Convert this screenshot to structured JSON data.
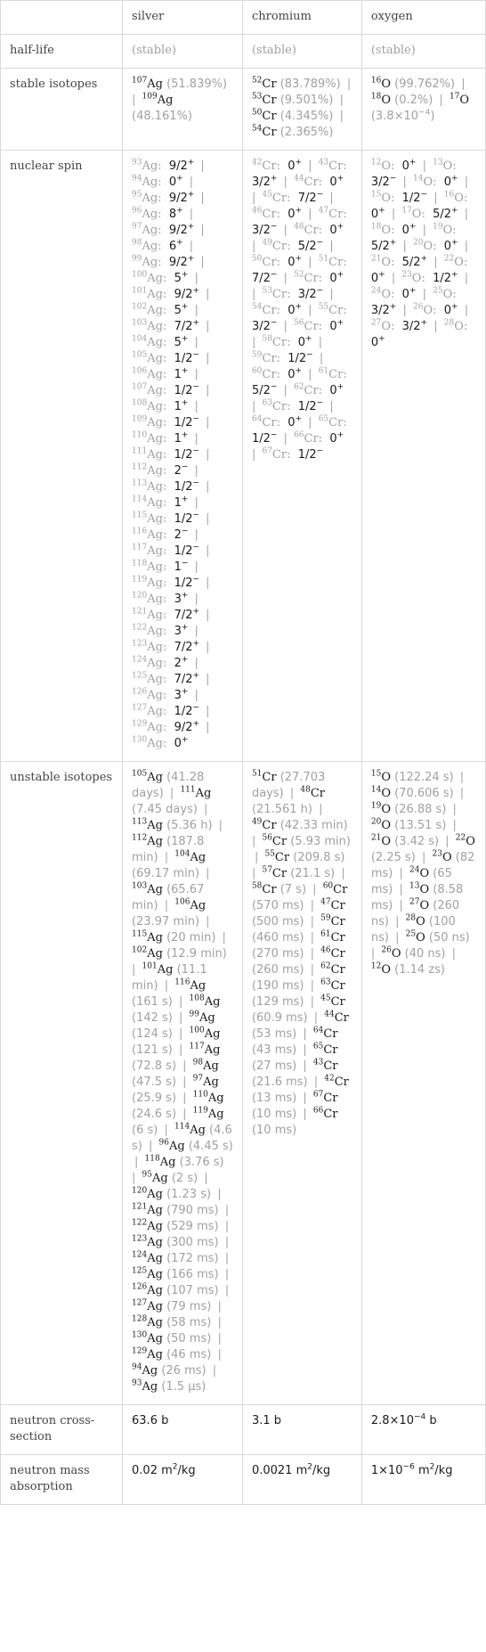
{
  "header": {
    "empty": "",
    "columns": [
      "silver",
      "chromium",
      "oxygen"
    ]
  },
  "rows": {
    "half_life": {
      "label": "half-life",
      "values": [
        "(stable)",
        "(stable)",
        "(stable)"
      ]
    },
    "stable_isotopes": {
      "label": "stable isotopes",
      "values": [
        [
          {
            "mass": "107",
            "sym": "Ag",
            "note": "(51.839%)"
          },
          {
            "mass": "109",
            "sym": "Ag",
            "note": "(48.161%)"
          }
        ],
        [
          {
            "mass": "52",
            "sym": "Cr",
            "note": "(83.789%)"
          },
          {
            "mass": "53",
            "sym": "Cr",
            "note": "(9.501%)"
          },
          {
            "mass": "50",
            "sym": "Cr",
            "note": "(4.345%)"
          },
          {
            "mass": "54",
            "sym": "Cr",
            "note": "(2.365%)"
          }
        ],
        [
          {
            "mass": "16",
            "sym": "O",
            "note": "(99.762%)"
          },
          {
            "mass": "18",
            "sym": "O",
            "note": "(0.2%)"
          },
          {
            "mass": "17",
            "sym": "O",
            "note": "(3.8×10^-4)"
          }
        ]
      ]
    },
    "nuclear_spin": {
      "label": "nuclear spin",
      "values": [
        [
          {
            "mass": "93",
            "sym": "Ag",
            "spin": "9/2",
            "parity": "+"
          },
          {
            "mass": "94",
            "sym": "Ag",
            "spin": "0",
            "parity": "+"
          },
          {
            "mass": "95",
            "sym": "Ag",
            "spin": "9/2",
            "parity": "+"
          },
          {
            "mass": "96",
            "sym": "Ag",
            "spin": "8",
            "parity": "+"
          },
          {
            "mass": "97",
            "sym": "Ag",
            "spin": "9/2",
            "parity": "+"
          },
          {
            "mass": "98",
            "sym": "Ag",
            "spin": "6",
            "parity": "+"
          },
          {
            "mass": "99",
            "sym": "Ag",
            "spin": "9/2",
            "parity": "+"
          },
          {
            "mass": "100",
            "sym": "Ag",
            "spin": "5",
            "parity": "+"
          },
          {
            "mass": "101",
            "sym": "Ag",
            "spin": "9/2",
            "parity": "+"
          },
          {
            "mass": "102",
            "sym": "Ag",
            "spin": "5",
            "parity": "+"
          },
          {
            "mass": "103",
            "sym": "Ag",
            "spin": "7/2",
            "parity": "+"
          },
          {
            "mass": "104",
            "sym": "Ag",
            "spin": "5",
            "parity": "+"
          },
          {
            "mass": "105",
            "sym": "Ag",
            "spin": "1/2",
            "parity": "-"
          },
          {
            "mass": "106",
            "sym": "Ag",
            "spin": "1",
            "parity": "+"
          },
          {
            "mass": "107",
            "sym": "Ag",
            "spin": "1/2",
            "parity": "-"
          },
          {
            "mass": "108",
            "sym": "Ag",
            "spin": "1",
            "parity": "+"
          },
          {
            "mass": "109",
            "sym": "Ag",
            "spin": "1/2",
            "parity": "-"
          },
          {
            "mass": "110",
            "sym": "Ag",
            "spin": "1",
            "parity": "+"
          },
          {
            "mass": "111",
            "sym": "Ag",
            "spin": "1/2",
            "parity": "-"
          },
          {
            "mass": "112",
            "sym": "Ag",
            "spin": "2",
            "parity": "-"
          },
          {
            "mass": "113",
            "sym": "Ag",
            "spin": "1/2",
            "parity": "-"
          },
          {
            "mass": "114",
            "sym": "Ag",
            "spin": "1",
            "parity": "+"
          },
          {
            "mass": "115",
            "sym": "Ag",
            "spin": "1/2",
            "parity": "-"
          },
          {
            "mass": "116",
            "sym": "Ag",
            "spin": "2",
            "parity": "-"
          },
          {
            "mass": "117",
            "sym": "Ag",
            "spin": "1/2",
            "parity": "-"
          },
          {
            "mass": "118",
            "sym": "Ag",
            "spin": "1",
            "parity": "-"
          },
          {
            "mass": "119",
            "sym": "Ag",
            "spin": "1/2",
            "parity": "-"
          },
          {
            "mass": "120",
            "sym": "Ag",
            "spin": "3",
            "parity": "+"
          },
          {
            "mass": "121",
            "sym": "Ag",
            "spin": "7/2",
            "parity": "+"
          },
          {
            "mass": "122",
            "sym": "Ag",
            "spin": "3",
            "parity": "+"
          },
          {
            "mass": "123",
            "sym": "Ag",
            "spin": "7/2",
            "parity": "+"
          },
          {
            "mass": "124",
            "sym": "Ag",
            "spin": "2",
            "parity": "+"
          },
          {
            "mass": "125",
            "sym": "Ag",
            "spin": "7/2",
            "parity": "+"
          },
          {
            "mass": "126",
            "sym": "Ag",
            "spin": "3",
            "parity": "+"
          },
          {
            "mass": "127",
            "sym": "Ag",
            "spin": "1/2",
            "parity": "-"
          },
          {
            "mass": "129",
            "sym": "Ag",
            "spin": "9/2",
            "parity": "+"
          },
          {
            "mass": "130",
            "sym": "Ag",
            "spin": "0",
            "parity": "+"
          }
        ],
        [
          {
            "mass": "42",
            "sym": "Cr",
            "spin": "0",
            "parity": "+"
          },
          {
            "mass": "43",
            "sym": "Cr",
            "spin": "3/2",
            "parity": "+"
          },
          {
            "mass": "44",
            "sym": "Cr",
            "spin": "0",
            "parity": "+"
          },
          {
            "mass": "45",
            "sym": "Cr",
            "spin": "7/2",
            "parity": "-"
          },
          {
            "mass": "46",
            "sym": "Cr",
            "spin": "0",
            "parity": "+"
          },
          {
            "mass": "47",
            "sym": "Cr",
            "spin": "3/2",
            "parity": "-"
          },
          {
            "mass": "48",
            "sym": "Cr",
            "spin": "0",
            "parity": "+"
          },
          {
            "mass": "49",
            "sym": "Cr",
            "spin": "5/2",
            "parity": "-"
          },
          {
            "mass": "50",
            "sym": "Cr",
            "spin": "0",
            "parity": "+"
          },
          {
            "mass": "51",
            "sym": "Cr",
            "spin": "7/2",
            "parity": "-"
          },
          {
            "mass": "52",
            "sym": "Cr",
            "spin": "0",
            "parity": "+"
          },
          {
            "mass": "53",
            "sym": "Cr",
            "spin": "3/2",
            "parity": "-"
          },
          {
            "mass": "54",
            "sym": "Cr",
            "spin": "0",
            "parity": "+"
          },
          {
            "mass": "55",
            "sym": "Cr",
            "spin": "3/2",
            "parity": "-"
          },
          {
            "mass": "56",
            "sym": "Cr",
            "spin": "0",
            "parity": "+"
          },
          {
            "mass": "58",
            "sym": "Cr",
            "spin": "0",
            "parity": "+"
          },
          {
            "mass": "59",
            "sym": "Cr",
            "spin": "1/2",
            "parity": "-"
          },
          {
            "mass": "60",
            "sym": "Cr",
            "spin": "0",
            "parity": "+"
          },
          {
            "mass": "61",
            "sym": "Cr",
            "spin": "5/2",
            "parity": "-"
          },
          {
            "mass": "62",
            "sym": "Cr",
            "spin": "0",
            "parity": "+"
          },
          {
            "mass": "63",
            "sym": "Cr",
            "spin": "1/2",
            "parity": "-"
          },
          {
            "mass": "64",
            "sym": "Cr",
            "spin": "0",
            "parity": "+"
          },
          {
            "mass": "65",
            "sym": "Cr",
            "spin": "1/2",
            "parity": "-"
          },
          {
            "mass": "66",
            "sym": "Cr",
            "spin": "0",
            "parity": "+"
          },
          {
            "mass": "67",
            "sym": "Cr",
            "spin": "1/2",
            "parity": "-"
          }
        ],
        [
          {
            "mass": "12",
            "sym": "O",
            "spin": "0",
            "parity": "+"
          },
          {
            "mass": "13",
            "sym": "O",
            "spin": "3/2",
            "parity": "-"
          },
          {
            "mass": "14",
            "sym": "O",
            "spin": "0",
            "parity": "+"
          },
          {
            "mass": "15",
            "sym": "O",
            "spin": "1/2",
            "parity": "-"
          },
          {
            "mass": "16",
            "sym": "O",
            "spin": "0",
            "parity": "+"
          },
          {
            "mass": "17",
            "sym": "O",
            "spin": "5/2",
            "parity": "+"
          },
          {
            "mass": "18",
            "sym": "O",
            "spin": "0",
            "parity": "+"
          },
          {
            "mass": "19",
            "sym": "O",
            "spin": "5/2",
            "parity": "+"
          },
          {
            "mass": "20",
            "sym": "O",
            "spin": "0",
            "parity": "+"
          },
          {
            "mass": "21",
            "sym": "O",
            "spin": "5/2",
            "parity": "+"
          },
          {
            "mass": "22",
            "sym": "O",
            "spin": "0",
            "parity": "+"
          },
          {
            "mass": "23",
            "sym": "O",
            "spin": "1/2",
            "parity": "+"
          },
          {
            "mass": "24",
            "sym": "O",
            "spin": "0",
            "parity": "+"
          },
          {
            "mass": "25",
            "sym": "O",
            "spin": "3/2",
            "parity": "+"
          },
          {
            "mass": "26",
            "sym": "O",
            "spin": "0",
            "parity": "+"
          },
          {
            "mass": "27",
            "sym": "O",
            "spin": "3/2",
            "parity": "+"
          },
          {
            "mass": "28",
            "sym": "O",
            "spin": "0",
            "parity": "+"
          }
        ]
      ]
    },
    "unstable_isotopes": {
      "label": "unstable isotopes",
      "values": [
        [
          {
            "mass": "105",
            "sym": "Ag",
            "note": "(41.28 days)"
          },
          {
            "mass": "111",
            "sym": "Ag",
            "note": "(7.45 days)"
          },
          {
            "mass": "113",
            "sym": "Ag",
            "note": "(5.36 h)"
          },
          {
            "mass": "112",
            "sym": "Ag",
            "note": "(187.8 min)"
          },
          {
            "mass": "104",
            "sym": "Ag",
            "note": "(69.17 min)"
          },
          {
            "mass": "103",
            "sym": "Ag",
            "note": "(65.67 min)"
          },
          {
            "mass": "106",
            "sym": "Ag",
            "note": "(23.97 min)"
          },
          {
            "mass": "115",
            "sym": "Ag",
            "note": "(20 min)"
          },
          {
            "mass": "102",
            "sym": "Ag",
            "note": "(12.9 min)"
          },
          {
            "mass": "101",
            "sym": "Ag",
            "note": "(11.1 min)"
          },
          {
            "mass": "116",
            "sym": "Ag",
            "note": "(161 s)"
          },
          {
            "mass": "108",
            "sym": "Ag",
            "note": "(142 s)"
          },
          {
            "mass": "99",
            "sym": "Ag",
            "note": "(124 s)"
          },
          {
            "mass": "100",
            "sym": "Ag",
            "note": "(121 s)"
          },
          {
            "mass": "117",
            "sym": "Ag",
            "note": "(72.8 s)"
          },
          {
            "mass": "98",
            "sym": "Ag",
            "note": "(47.5 s)"
          },
          {
            "mass": "97",
            "sym": "Ag",
            "note": "(25.9 s)"
          },
          {
            "mass": "110",
            "sym": "Ag",
            "note": "(24.6 s)"
          },
          {
            "mass": "119",
            "sym": "Ag",
            "note": "(6 s)"
          },
          {
            "mass": "114",
            "sym": "Ag",
            "note": "(4.6 s)"
          },
          {
            "mass": "96",
            "sym": "Ag",
            "note": "(4.45 s)"
          },
          {
            "mass": "118",
            "sym": "Ag",
            "note": "(3.76 s)"
          },
          {
            "mass": "95",
            "sym": "Ag",
            "note": "(2 s)"
          },
          {
            "mass": "120",
            "sym": "Ag",
            "note": "(1.23 s)"
          },
          {
            "mass": "121",
            "sym": "Ag",
            "note": "(790 ms)"
          },
          {
            "mass": "122",
            "sym": "Ag",
            "note": "(529 ms)"
          },
          {
            "mass": "123",
            "sym": "Ag",
            "note": "(300 ms)"
          },
          {
            "mass": "124",
            "sym": "Ag",
            "note": "(172 ms)"
          },
          {
            "mass": "125",
            "sym": "Ag",
            "note": "(166 ms)"
          },
          {
            "mass": "126",
            "sym": "Ag",
            "note": "(107 ms)"
          },
          {
            "mass": "127",
            "sym": "Ag",
            "note": "(79 ms)"
          },
          {
            "mass": "128",
            "sym": "Ag",
            "note": "(58 ms)"
          },
          {
            "mass": "130",
            "sym": "Ag",
            "note": "(50 ms)"
          },
          {
            "mass": "129",
            "sym": "Ag",
            "note": "(46 ms)"
          },
          {
            "mass": "94",
            "sym": "Ag",
            "note": "(26 ms)"
          },
          {
            "mass": "93",
            "sym": "Ag",
            "note": "(1.5 μs)"
          }
        ],
        [
          {
            "mass": "51",
            "sym": "Cr",
            "note": "(27.703 days)"
          },
          {
            "mass": "48",
            "sym": "Cr",
            "note": "(21.561 h)"
          },
          {
            "mass": "49",
            "sym": "Cr",
            "note": "(42.33 min)"
          },
          {
            "mass": "56",
            "sym": "Cr",
            "note": "(5.93 min)"
          },
          {
            "mass": "55",
            "sym": "Cr",
            "note": "(209.8 s)"
          },
          {
            "mass": "57",
            "sym": "Cr",
            "note": "(21.1 s)"
          },
          {
            "mass": "58",
            "sym": "Cr",
            "note": "(7 s)"
          },
          {
            "mass": "60",
            "sym": "Cr",
            "note": "(570 ms)"
          },
          {
            "mass": "47",
            "sym": "Cr",
            "note": "(500 ms)"
          },
          {
            "mass": "59",
            "sym": "Cr",
            "note": "(460 ms)"
          },
          {
            "mass": "61",
            "sym": "Cr",
            "note": "(270 ms)"
          },
          {
            "mass": "46",
            "sym": "Cr",
            "note": "(260 ms)"
          },
          {
            "mass": "62",
            "sym": "Cr",
            "note": "(190 ms)"
          },
          {
            "mass": "63",
            "sym": "Cr",
            "note": "(129 ms)"
          },
          {
            "mass": "45",
            "sym": "Cr",
            "note": "(60.9 ms)"
          },
          {
            "mass": "44",
            "sym": "Cr",
            "note": "(53 ms)"
          },
          {
            "mass": "64",
            "sym": "Cr",
            "note": "(43 ms)"
          },
          {
            "mass": "65",
            "sym": "Cr",
            "note": "(27 ms)"
          },
          {
            "mass": "43",
            "sym": "Cr",
            "note": "(21.6 ms)"
          },
          {
            "mass": "42",
            "sym": "Cr",
            "note": "(13 ms)"
          },
          {
            "mass": "67",
            "sym": "Cr",
            "note": "(10 ms)"
          },
          {
            "mass": "66",
            "sym": "Cr",
            "note": "(10 ms)"
          }
        ],
        [
          {
            "mass": "15",
            "sym": "O",
            "note": "(122.24 s)"
          },
          {
            "mass": "14",
            "sym": "O",
            "note": "(70.606 s)"
          },
          {
            "mass": "19",
            "sym": "O",
            "note": "(26.88 s)"
          },
          {
            "mass": "20",
            "sym": "O",
            "note": "(13.51 s)"
          },
          {
            "mass": "21",
            "sym": "O",
            "note": "(3.42 s)"
          },
          {
            "mass": "22",
            "sym": "O",
            "note": "(2.25 s)"
          },
          {
            "mass": "23",
            "sym": "O",
            "note": "(82 ms)"
          },
          {
            "mass": "24",
            "sym": "O",
            "note": "(65 ms)"
          },
          {
            "mass": "13",
            "sym": "O",
            "note": "(8.58 ms)"
          },
          {
            "mass": "27",
            "sym": "O",
            "note": "(260 ns)"
          },
          {
            "mass": "28",
            "sym": "O",
            "note": "(100 ns)"
          },
          {
            "mass": "25",
            "sym": "O",
            "note": "(50 ns)"
          },
          {
            "mass": "26",
            "sym": "O",
            "note": "(40 ns)"
          },
          {
            "mass": "12",
            "sym": "O",
            "note": "(1.14 zs)"
          }
        ]
      ]
    },
    "neutron_cross_section": {
      "label": "neutron cross-section",
      "values": [
        "63.6 b",
        "3.1 b",
        "2.8×10^-4 b"
      ]
    },
    "neutron_mass_absorption": {
      "label": "neutron mass absorption",
      "values": [
        "0.02 m^2/kg",
        "0.0021 m^2/kg",
        "1×10^-6 m^2/kg"
      ]
    }
  }
}
